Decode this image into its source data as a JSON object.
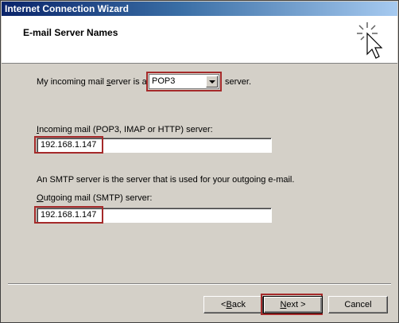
{
  "window": {
    "title": "Internet Connection Wizard"
  },
  "header": {
    "title": "E-mail Server Names"
  },
  "incoming_type": {
    "prefix": "My incoming mail ",
    "prefix_u": "s",
    "prefix_rest": "erver is a",
    "suffix": "server.",
    "selected": "POP3"
  },
  "incoming": {
    "label_u": "I",
    "label_rest": "ncoming mail (POP3, IMAP or HTTP) server:",
    "value": "192.168.1.147"
  },
  "smtp_note": "An SMTP server is the server that is used for your outgoing e-mail.",
  "outgoing": {
    "label_u": "O",
    "label_rest": "utgoing mail (SMTP) server:",
    "value": "192.168.1.147"
  },
  "buttons": {
    "back_prefix": "< ",
    "back_u": "B",
    "back_rest": "ack",
    "next_u": "N",
    "next_rest": "ext >",
    "cancel": "Cancel"
  },
  "colors": {
    "highlight": "#a52a2a",
    "title_bar": "#0a246a",
    "face": "#d4d0c8"
  },
  "icons": [
    "wizard-cursor-sparkle-icon",
    "dropdown-arrow-icon"
  ]
}
